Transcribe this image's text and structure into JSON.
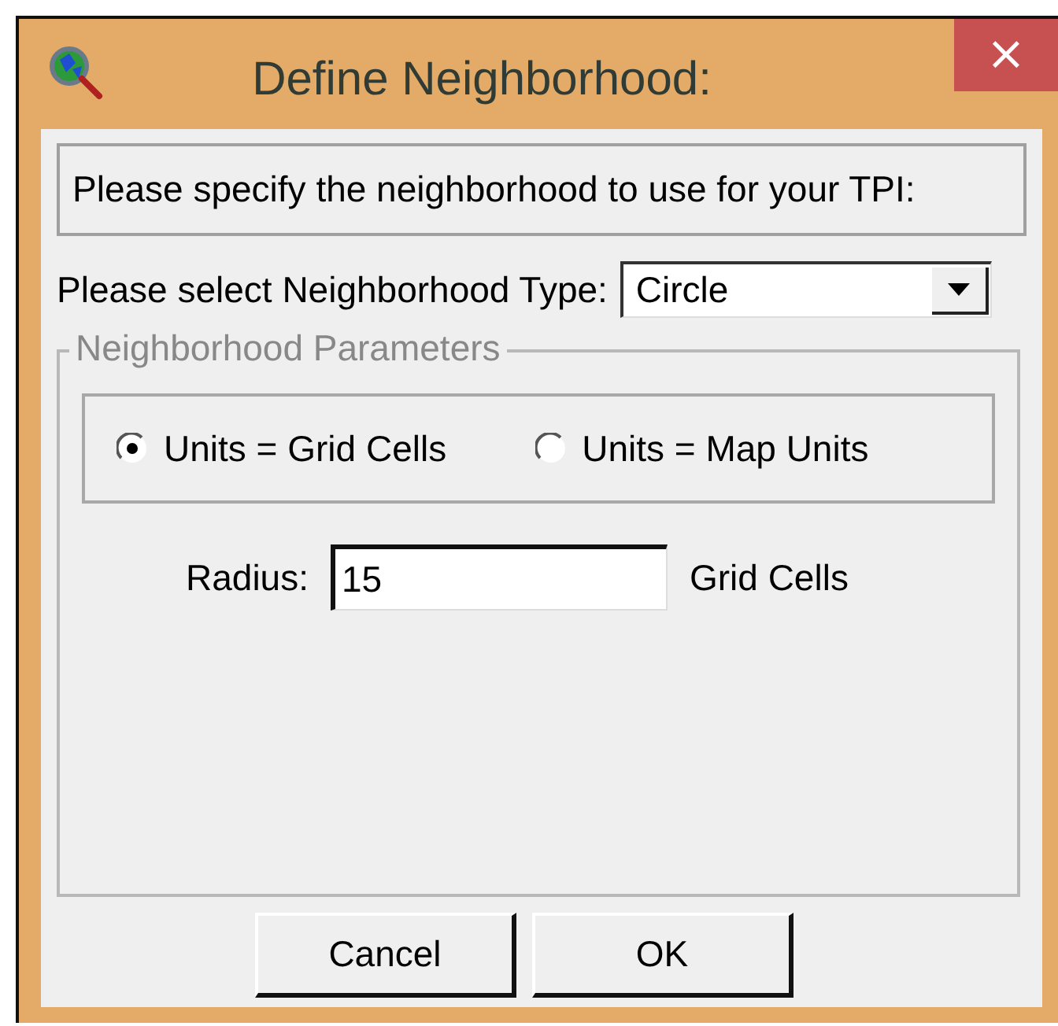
{
  "window": {
    "title": "Define Neighborhood:",
    "close": "×"
  },
  "prompt": "Please specify the neighborhood to use for your TPI:",
  "type_field": {
    "label": "Please select Neighborhood Type:",
    "value": "Circle"
  },
  "group": {
    "title": "Neighborhood Parameters"
  },
  "units": [
    {
      "label": "Units = Grid Cells",
      "selected": true
    },
    {
      "label": "Units = Map Units",
      "selected": false
    }
  ],
  "radius": {
    "label": "Radius:",
    "value": "15",
    "unit": "Grid Cells"
  },
  "buttons": [
    "Cancel",
    "OK"
  ]
}
